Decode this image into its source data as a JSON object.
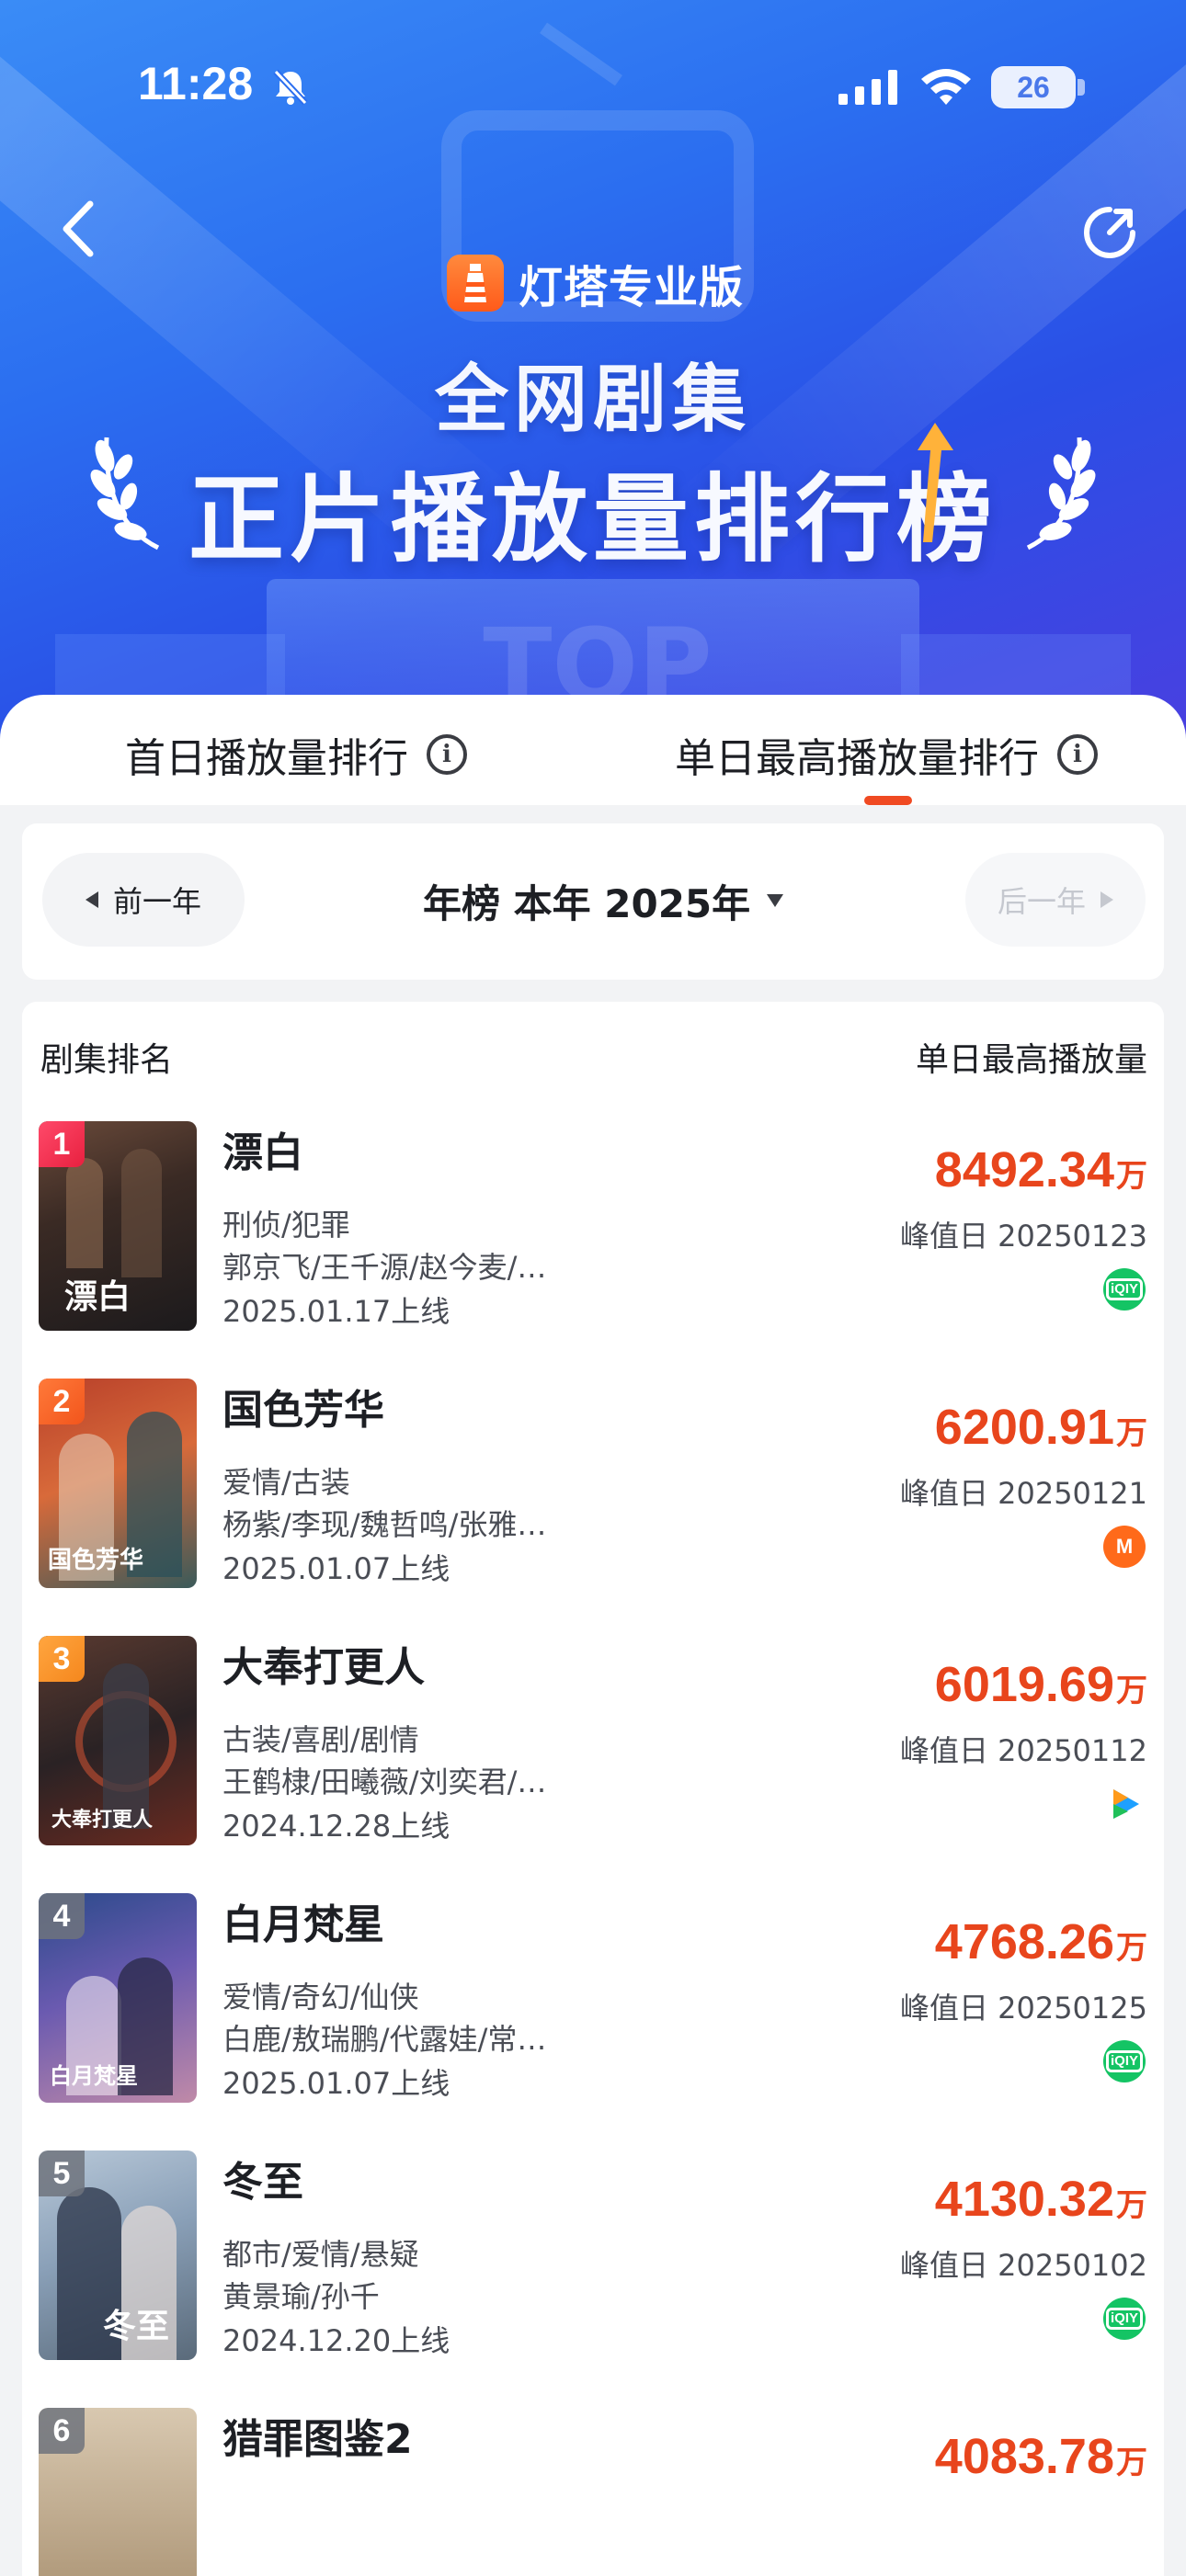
{
  "status_bar": {
    "time": "11:28",
    "battery": "26"
  },
  "header": {
    "brand": "灯塔专业版",
    "title_line1": "全网剧集",
    "title_line2": "正片播放量排行榜",
    "bg_text": "TOP"
  },
  "tabs": [
    {
      "label": "首日播放量排行",
      "active": false
    },
    {
      "label": "单日最高播放量排行",
      "active": true
    }
  ],
  "year_selector": {
    "prev_label": "前一年",
    "current_label": "年榜 本年 2025年",
    "next_label": "后一年"
  },
  "list": {
    "col_left": "剧集排名",
    "col_right": "单日最高播放量",
    "unit": "万",
    "peak_prefix": "峰值日",
    "rows": [
      {
        "rank": "1",
        "title": "漂白",
        "genre": "刑侦/犯罪",
        "cast": "郭京飞/王千源/赵今麦/…",
        "date": "2025.01.17上线",
        "value": "8492.34",
        "peak": "峰值日 20250123",
        "platform": "iqiyi",
        "poster_text": "漂白"
      },
      {
        "rank": "2",
        "title": "国色芳华",
        "genre": "爱情/古装",
        "cast": "杨紫/李现/魏哲鸣/张雅…",
        "date": "2025.01.07上线",
        "value": "6200.91",
        "peak": "峰值日 20250121",
        "platform": "mgtv",
        "poster_text": "国色芳华"
      },
      {
        "rank": "3",
        "title": "大奉打更人",
        "genre": "古装/喜剧/剧情",
        "cast": "王鹤棣/田曦薇/刘奕君/…",
        "date": "2024.12.28上线",
        "value": "6019.69",
        "peak": "峰值日 20250112",
        "platform": "tencent",
        "poster_text": "大奉打更人"
      },
      {
        "rank": "4",
        "title": "白月梵星",
        "genre": "爱情/奇幻/仙侠",
        "cast": "白鹿/敖瑞鹏/代露娃/常…",
        "date": "2025.01.07上线",
        "value": "4768.26",
        "peak": "峰值日 20250125",
        "platform": "iqiyi",
        "poster_text": "白月梵星"
      },
      {
        "rank": "5",
        "title": "冬至",
        "genre": "都市/爱情/悬疑",
        "cast": "黄景瑜/孙千",
        "date": "2024.12.20上线",
        "value": "4130.32",
        "peak": "峰值日 20250102",
        "platform": "iqiyi",
        "poster_text": "冬至"
      },
      {
        "rank": "6",
        "title": "猎罪图鉴2",
        "genre": "",
        "cast": "",
        "date": "",
        "value": "4083.78",
        "peak": "",
        "platform": "",
        "poster_text": ""
      }
    ]
  },
  "colors": {
    "accent": "#e8451c",
    "rank1": "#e8203f",
    "rank2": "#f2551c",
    "rank3": "#f5871d",
    "banner_top": "#3a8cf6",
    "banner_bottom": "#2a4fe6"
  }
}
